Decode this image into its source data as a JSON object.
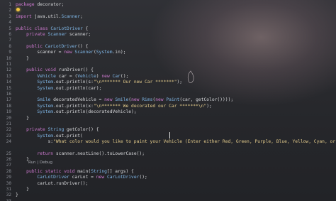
{
  "editor": {
    "code_lines": [
      {
        "n": "1",
        "text": "package decorator;"
      },
      {
        "n": "2",
        "text": ""
      },
      {
        "n": "3",
        "text": "import java.util.Scanner;"
      },
      {
        "n": "4",
        "text": ""
      },
      {
        "n": "5",
        "text": "public class CarLotDriver {"
      },
      {
        "n": "6",
        "text": "    private Scanner scanner;"
      },
      {
        "n": "7",
        "text": ""
      },
      {
        "n": "8",
        "text": "    public CarLotDriver() {"
      },
      {
        "n": "9",
        "text": "        scanner = new Scanner(System.in);"
      },
      {
        "n": "10",
        "text": "    }"
      },
      {
        "n": "11",
        "text": ""
      },
      {
        "n": "12",
        "text": "    public void runDriver() {"
      },
      {
        "n": "13",
        "text": "        Vehicle car = (Vehicle) new Car();"
      },
      {
        "n": "14",
        "text": "        System.out.println(s:\"\\n******* Our new Car *******\");"
      },
      {
        "n": "15",
        "text": "        System.out.println(car);"
      },
      {
        "n": "16",
        "text": ""
      },
      {
        "n": "17",
        "text": "        Smile decoratedVehicle = new Smile(new Rims(new Paint(car, getColor())));"
      },
      {
        "n": "18",
        "text": "        System.out.println(x:\"\\n******* We decorated our Car *******\\n\");"
      },
      {
        "n": "19",
        "text": "        System.out.println(decoratedVehicle);"
      },
      {
        "n": "20",
        "text": "    }"
      },
      {
        "n": "21",
        "text": ""
      },
      {
        "n": "22",
        "text": "    private String getColor() {"
      },
      {
        "n": "23",
        "text": "        System.out.print("
      },
      {
        "n": "24",
        "text": "            s:\"What color would you like to paint your Vehicle (Enter either Red, Green, Purple, Blue, Yellow, Cyan, or None): \");"
      },
      {
        "n": "25",
        "text": "        return scanner.nextLine().toLowerCase();"
      },
      {
        "n": "26",
        "text": "    }"
      },
      {
        "n": "27",
        "text": ""
      },
      {
        "n": "28",
        "text": "    public static void main(String[] args) {"
      },
      {
        "n": "29",
        "text": "        CarLotDriver carLot = new CarLotDriver();"
      },
      {
        "n": "30",
        "text": "        carLot.runDriver();"
      },
      {
        "n": "31",
        "text": "    }"
      },
      {
        "n": "32",
        "text": "}"
      },
      {
        "n": "33",
        "text": ""
      }
    ],
    "codelens": "Run | Debug",
    "colors": {
      "background": "#2b2c30",
      "keyword": "#cf7ad1",
      "type": "#7fb6e6",
      "string": "#e1c98a",
      "text": "#d6d7da",
      "line_number": "#8b8e96"
    },
    "icons": [
      "lightbulb-icon",
      "text-cursor-icon"
    ]
  }
}
